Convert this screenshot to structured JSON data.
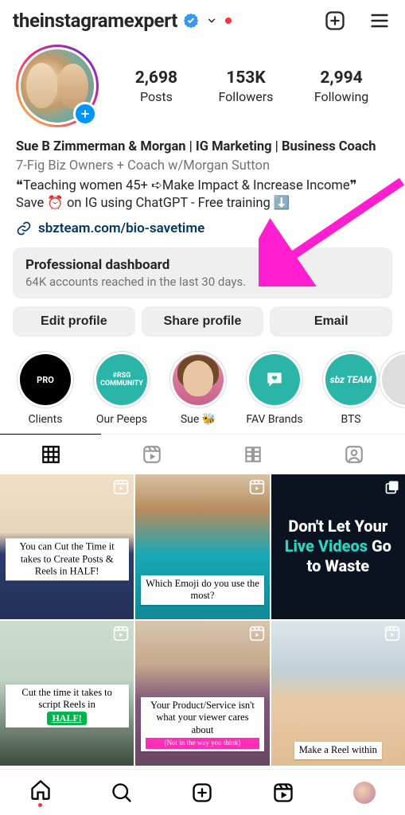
{
  "header": {
    "username": "theinstagramexpert",
    "verified": true
  },
  "stats": {
    "posts": {
      "num": "2,698",
      "label": "Posts"
    },
    "followers": {
      "num": "153K",
      "label": "Followers"
    },
    "following": {
      "num": "2,994",
      "label": "Following"
    }
  },
  "bio": {
    "name": "Sue B Zimmerman & Morgan | IG Marketing | Business Coach",
    "category": "7-Fig Biz Owners + Coach w/Morgan Sutton",
    "line1": "❝Teaching women 45+ ➪Make Impact & Increase Income❞",
    "line2": "Save ⏰ on IG using ChatGPT - Free training ⬇️",
    "link": "sbzteam.com/bio-savetime"
  },
  "dashboard": {
    "title": "Professional dashboard",
    "subtitle": "64K accounts reached in the last 30 days."
  },
  "actions": {
    "edit": "Edit profile",
    "share": "Share profile",
    "email": "Email"
  },
  "highlights": [
    {
      "label": "Clients",
      "text": "PRO"
    },
    {
      "label": "Our Peeps",
      "text": "#RSG COMMUNITY"
    },
    {
      "label": "Sue 🐝",
      "text": ""
    },
    {
      "label": "FAV Brands",
      "text": ""
    },
    {
      "label": "BTS",
      "text": "sbz TEAM"
    }
  ],
  "grid": [
    {
      "caption": "You can Cut the Time it takes to Create Posts & Reels in HALF!",
      "type": "reel"
    },
    {
      "caption": "Which Emoji do you use the most?",
      "type": "reel"
    },
    {
      "headline_pre": "Don't Let Your ",
      "headline_accent": "Live Videos",
      "headline_post": " Go to Waste",
      "type": "multi"
    },
    {
      "caption": "Cut the time it takes to script Reels in",
      "badge": "HALF!",
      "type": "reel"
    },
    {
      "caption": "Your Product/Service isn't what your viewer cares about",
      "subnote": "(Not in the way you think)",
      "type": "reel"
    },
    {
      "caption": "Make a Reel within",
      "type": "reel"
    }
  ]
}
